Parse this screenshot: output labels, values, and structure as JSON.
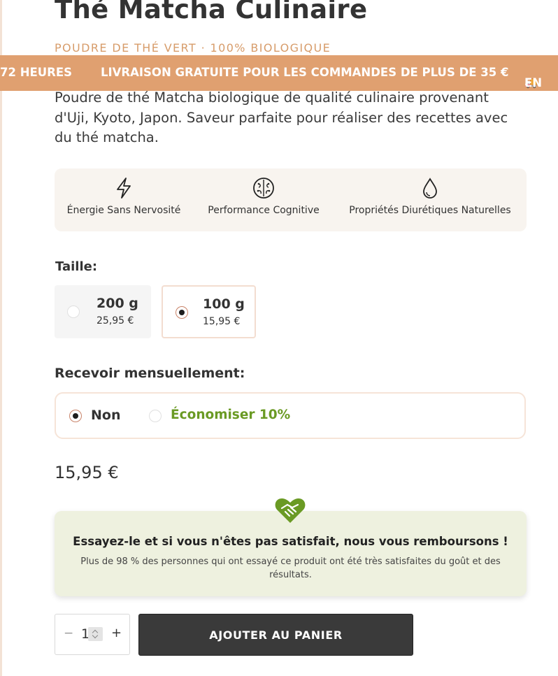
{
  "product": {
    "title": "Thé Matcha Culinaire",
    "subtitle": "POUDRE DE THÉ VERT · 100% BIOLOGIQUE",
    "description": "Poudre de thé Matcha biologique de qualité culinaire provenant d'Uji, Kyoto, Japon. Saveur parfaite pour réaliser des recettes avec du thé matcha."
  },
  "ticker": {
    "items": [
      "72 HEURES",
      "LIVRAISON GRATUITE POUR LES COMMANDES DE PLUS DE 35 €",
      "EN"
    ],
    "icon": "truck-emoji"
  },
  "benefits": [
    {
      "icon": "lightning-icon",
      "label": "Énergie Sans Nervosité"
    },
    {
      "icon": "brain-icon",
      "label": "Performance Cognitive"
    },
    {
      "icon": "water-drop-icon",
      "label": "Propriétés Diurétiques Naturelles"
    }
  ],
  "size": {
    "label": "Taille:",
    "options": [
      {
        "weight": "200 g",
        "price": "25,95 €",
        "selected": false
      },
      {
        "weight": "100 g",
        "price": "15,95 €",
        "selected": true
      }
    ]
  },
  "subscription": {
    "label": "Recevoir mensuellement:",
    "options": [
      {
        "label": "Non",
        "selected": true
      },
      {
        "label": "Économiser 10%",
        "selected": false
      }
    ],
    "save_color": "#6a9a24"
  },
  "price": "15,95 €",
  "guarantee": {
    "icon": "handshake-heart-icon",
    "title": "Essayez-le et si vous n'êtes pas satisfait, nous vous remboursons !",
    "text": "Plus de 98 % des personnes qui ont essayé ce produit ont été très satisfaites du goût et des résultats."
  },
  "cart": {
    "quantity": "1",
    "minus": "−",
    "plus": "+",
    "add_label": "AJOUTER AU PANIER"
  },
  "colors": {
    "accent": "#e0a070",
    "subtitle": "#d79c6a",
    "button": "#3a3a3a",
    "guarantee_bg": "#eef1df",
    "guarantee_icon": "#6a9a24"
  }
}
